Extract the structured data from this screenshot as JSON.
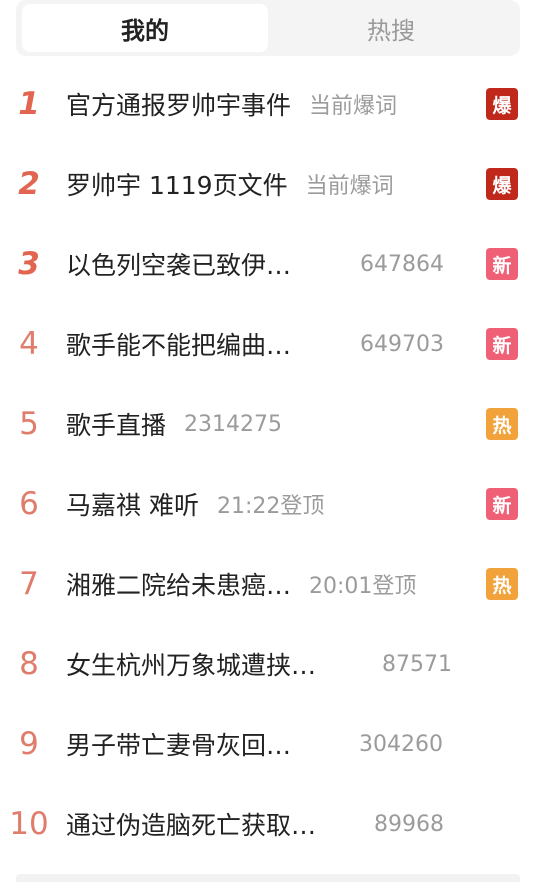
{
  "tabs": {
    "active": "我的",
    "inactive": "热搜"
  },
  "colors": {
    "bao": "#c0281c",
    "xin": "#ef5f75",
    "re": "#f2a23a"
  },
  "items": [
    {
      "rank": "1",
      "title": "官方通报罗帅宇事件",
      "meta": "当前爆词",
      "badge": "爆",
      "badge_type": "bao"
    },
    {
      "rank": "2",
      "title": "罗帅宇 1119页文件",
      "meta": "当前爆词",
      "badge": "爆",
      "badge_type": "bao"
    },
    {
      "rank": "3",
      "title": "以色列空袭已致伊…",
      "meta": "647864",
      "badge": "新",
      "badge_type": "xin"
    },
    {
      "rank": "4",
      "title": "歌手能不能把编曲…",
      "meta": "649703",
      "badge": "新",
      "badge_type": "xin"
    },
    {
      "rank": "5",
      "title": "歌手直播",
      "meta": "2314275",
      "badge": "热",
      "badge_type": "re"
    },
    {
      "rank": "6",
      "title": "马嘉祺 难听",
      "meta": "21:22登顶",
      "badge": "新",
      "badge_type": "xin"
    },
    {
      "rank": "7",
      "title": "湘雅二院给未患癌…",
      "meta": "20:01登顶",
      "badge": "热",
      "badge_type": "re"
    },
    {
      "rank": "8",
      "title": "女生杭州万象城遭挟…",
      "meta": "87571",
      "badge": "",
      "badge_type": ""
    },
    {
      "rank": "9",
      "title": "男子带亡妻骨灰回…",
      "meta": "304260",
      "badge": "",
      "badge_type": ""
    },
    {
      "rank": "10",
      "title": "通过伪造脑死亡获取…",
      "meta": "89968",
      "badge": "",
      "badge_type": ""
    }
  ]
}
